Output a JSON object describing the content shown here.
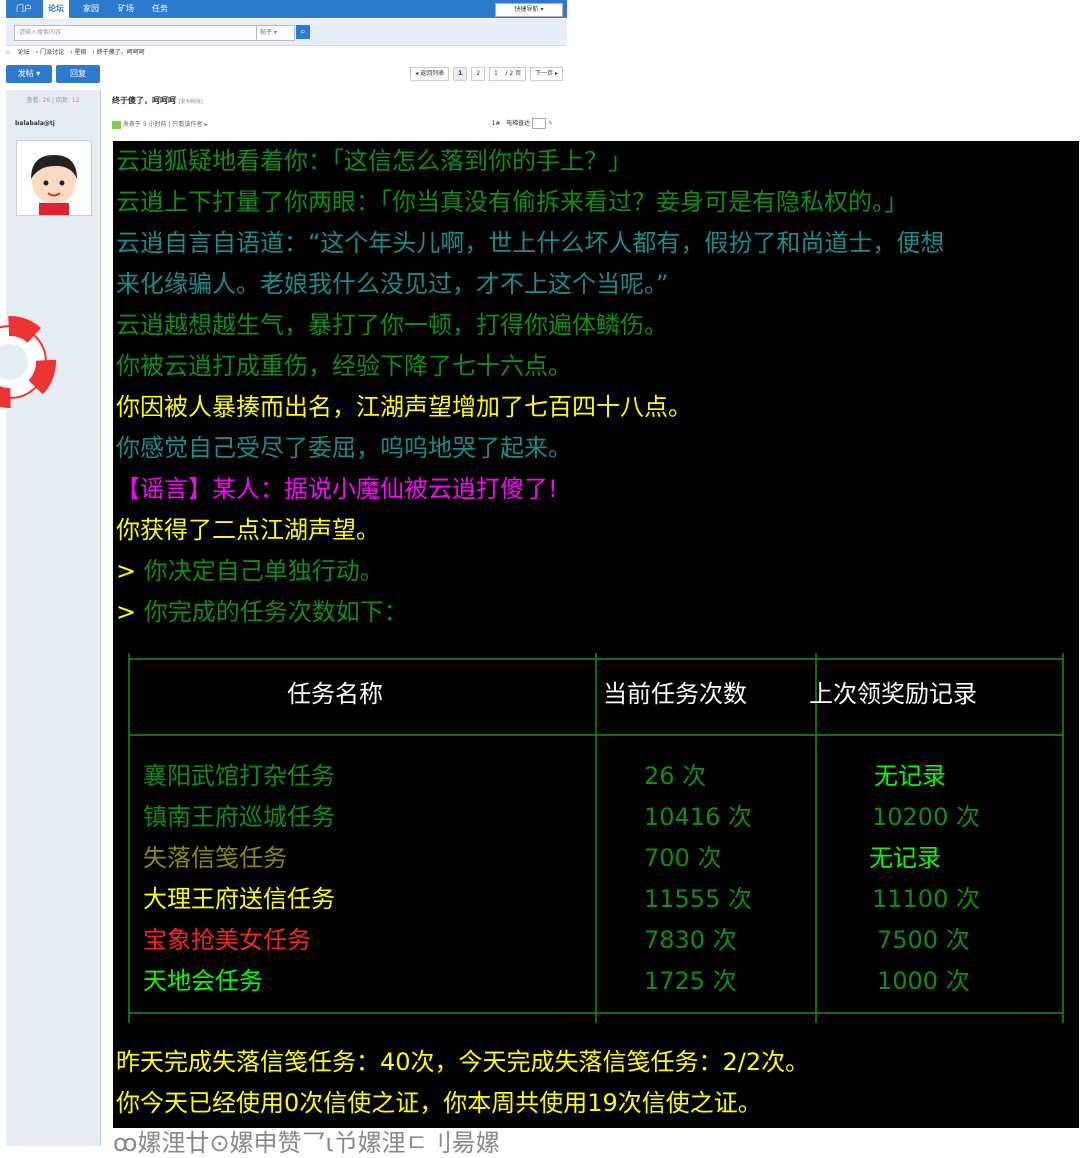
{
  "forum": {
    "nav": [
      "门户",
      "论坛",
      "家园",
      "矿场",
      "任务"
    ],
    "active_nav": "论坛",
    "quick_nav": "快捷导航",
    "search_placeholder": "请输入搜索内容",
    "search_scope": "帖子",
    "breadcrumb": [
      "论坛",
      "门派讨论",
      "星宿",
      "终于傻了，呵呵呵"
    ],
    "post_button": "发帖",
    "reply_button": "回复",
    "pager": {
      "back": "返回列表",
      "pages": [
        "1",
        "2"
      ],
      "current_input": "1",
      "total": "/ 2 页",
      "next": "下一页"
    },
    "stats": {
      "views_label": "查看:",
      "views": "26",
      "replies_label": "回复:",
      "replies": "12"
    },
    "thread_title": "终于傻了，呵呵呵",
    "copy_link": "[复制链接]",
    "author": "balabala@tj",
    "post_meta": "发表于 5 小时前",
    "only_author": "只看该作者",
    "floor": "1#",
    "electric_direct": "电梯直达"
  },
  "game_log": {
    "lines": [
      {
        "text": "云逍狐疑地看着你：「这信怎么落到你的手上？」",
        "color": "#128f12"
      },
      {
        "text": "云逍上下打量了你两眼：「你当真没有偷拆来看过？妾身可是有隐私权的。」",
        "color": "#128f12"
      },
      {
        "text": "云逍自言自语道：“这个年头儿啊，世上什么坏人都有，假扮了和尚道士，便想",
        "color": "#1a8c8c"
      },
      {
        "text": "来化缘骗人。老娘我什么没见过，才不上这个当呢。”",
        "color": "#1a8c8c"
      },
      {
        "text": "云逍越想越生气，暴打了你一顿，打得你遍体鳞伤。",
        "color": "#128f12"
      },
      {
        "text": "你被云逍打成重伤，经验下降了七十六点。",
        "color": "#128f12"
      },
      {
        "text": "你因被人暴揍而出名，江湖声望增加了七百四十八点。",
        "color": "#ffff00"
      },
      {
        "text": "你感觉自己受尽了委屈，呜呜地哭了起来。",
        "color": "#1a8c8c"
      },
      {
        "text": "【谣言】某人：据说小魔仙被云逍打傻了!",
        "color": "#ff00ff"
      },
      {
        "text": "你获得了二点江湖声望。",
        "color": "#ffff00"
      }
    ],
    "prompts": [
      {
        "prompt": ">",
        "text": "你决定自己单独行动。"
      },
      {
        "prompt": ">",
        "text": "你完成的任务次数如下："
      }
    ],
    "table": {
      "headers": [
        "任务名称",
        "当前任务次数",
        "上次领奖励记录"
      ],
      "rows": [
        {
          "name": "襄阳武馆打杂任务",
          "count": "26 次",
          "last": "无记录",
          "name_color": "#128f12",
          "last_color": "#00ff00"
        },
        {
          "name": "镇南王府巡城任务",
          "count": "10416 次",
          "last": "10200 次",
          "name_color": "#128f12",
          "last_color": "#128f12"
        },
        {
          "name": "失落信笺任务",
          "count": "700 次",
          "last": "无记录",
          "name_color": "#8a8a10",
          "last_color": "#00ff00"
        },
        {
          "name": "大理王府送信任务",
          "count": "11555 次",
          "last": "11100 次",
          "name_color": "#ffff00",
          "last_color": "#128f12"
        },
        {
          "name": "宝象抢美女任务",
          "count": "7830 次",
          "last": "7500 次",
          "name_color": "#ff2020",
          "last_color": "#128f12"
        },
        {
          "name": "天地会任务",
          "count": "1725 次",
          "last": "1000 次",
          "name_color": "#00ff00",
          "last_color": "#128f12"
        }
      ]
    },
    "footer_lines": [
      "昨天完成失落信笺任务：40次，今天完成失落信笺任务：2/2次。",
      "你今天已经使用0次信使之证，你本周共使用19次信使之证。"
    ],
    "cut_text": "ꝏ嫘浬廿⊙嫘申赞乛ι兯嫘浬ㄷ刂昜嫘"
  },
  "colors": {
    "nav_blue": "#2b7acd",
    "panel_bg": "#000000",
    "border_green": "#1a8c1a"
  }
}
